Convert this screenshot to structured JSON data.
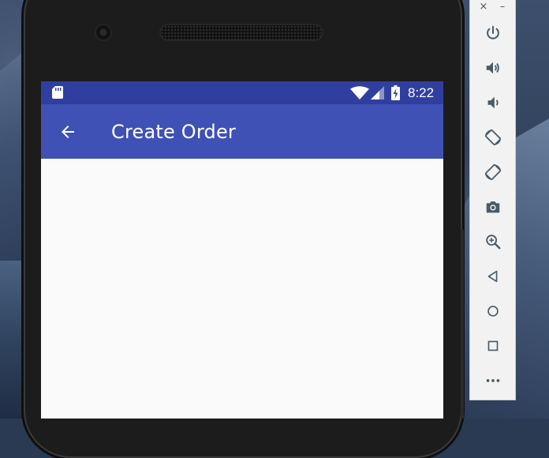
{
  "status_bar": {
    "time": "8:22"
  },
  "app_bar": {
    "title": "Create Order"
  },
  "emulator_panel": {
    "close_glyph": "×",
    "minimize_glyph": "–",
    "buttons": [
      {
        "name": "power-icon"
      },
      {
        "name": "volume-up-icon"
      },
      {
        "name": "volume-down-icon"
      },
      {
        "name": "rotate-left-icon"
      },
      {
        "name": "rotate-right-icon"
      },
      {
        "name": "camera-icon"
      },
      {
        "name": "zoom-icon"
      },
      {
        "name": "back-triangle-icon"
      },
      {
        "name": "home-circle-icon"
      },
      {
        "name": "overview-square-icon"
      },
      {
        "name": "more-icon"
      }
    ]
  },
  "colors": {
    "status_bar": "#303f9f",
    "app_bar": "#3f51b5",
    "screen_background": "#fafafa",
    "panel_icon": "#4a5a66"
  }
}
